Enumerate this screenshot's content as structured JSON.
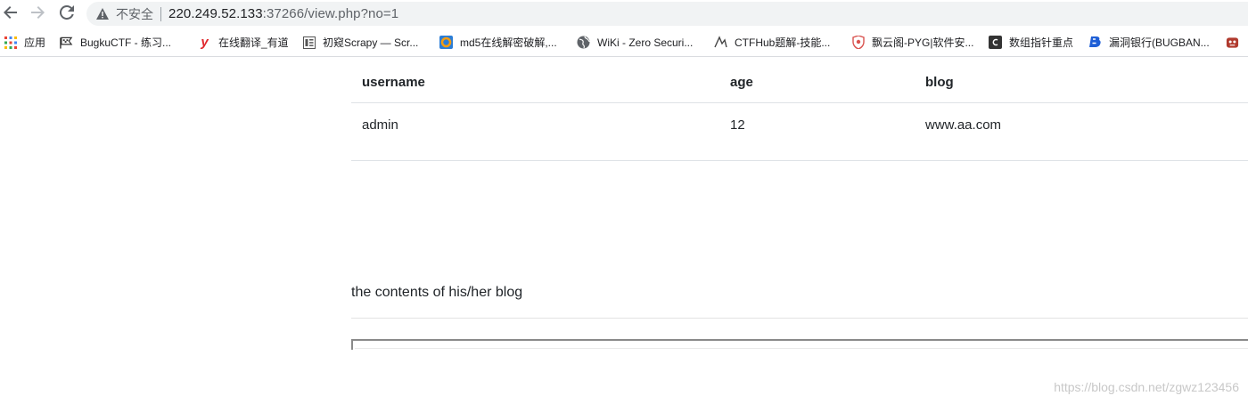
{
  "browser": {
    "security_label": "不安全",
    "url_host": "220.249.52.133",
    "url_rest": ":37266/view.php?no=1"
  },
  "bookmarks": [
    {
      "label": "应用",
      "icon": "apps-grid-icon"
    },
    {
      "label": "BugkuCTF - 练习...",
      "icon": "flag-icon"
    },
    {
      "label": "在线翻译_有道",
      "icon": "youdao-icon"
    },
    {
      "label": "初窥Scrapy — Scr...",
      "icon": "doc-page-icon"
    },
    {
      "label": "md5在线解密破解,...",
      "icon": "md5-icon"
    },
    {
      "label": "WiKi - Zero Securi...",
      "icon": "globe-icon"
    },
    {
      "label": "CTFHub题解-技能...",
      "icon": "ctfhub-icon"
    },
    {
      "label": "飘云阁-PYG|软件安...",
      "icon": "shield-icon"
    },
    {
      "label": "数组指针重点",
      "icon": "csdn-icon"
    },
    {
      "label": "漏洞银行(BUGBAN...",
      "icon": "bugbank-icon"
    },
    {
      "label": "",
      "icon": "extension-icon"
    }
  ],
  "table": {
    "headers": [
      "username",
      "age",
      "blog"
    ],
    "rows": [
      [
        "admin",
        "12",
        "www.aa.com"
      ]
    ]
  },
  "blog_section": {
    "text": "the contents of his/her blog"
  },
  "watermark": "https://blog.csdn.net/zgwz123456"
}
